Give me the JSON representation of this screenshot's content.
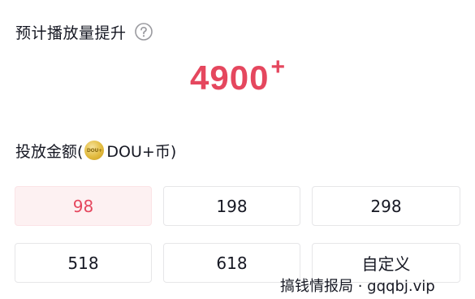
{
  "header": {
    "title": "预计播放量提升",
    "help_icon": "question-circle-icon"
  },
  "estimate": {
    "value": "4900",
    "suffix": "+"
  },
  "amount": {
    "label_prefix": "投放金额(",
    "coin_icon": "dou-coin-icon",
    "coin_text": "DOU+",
    "label_suffix": "DOU+币)"
  },
  "options": [
    {
      "label": "98",
      "selected": true
    },
    {
      "label": "198",
      "selected": false
    },
    {
      "label": "298",
      "selected": false
    },
    {
      "label": "518",
      "selected": false
    },
    {
      "label": "618",
      "selected": false
    },
    {
      "label": "自定义",
      "selected": false
    }
  ],
  "watermark": {
    "text": "搞钱情报局 · gqqbj.vip"
  },
  "colors": {
    "accent": "#e5475e",
    "selected_bg": "#fdf1f2",
    "text": "#161823",
    "border": "#e6e6e8"
  }
}
